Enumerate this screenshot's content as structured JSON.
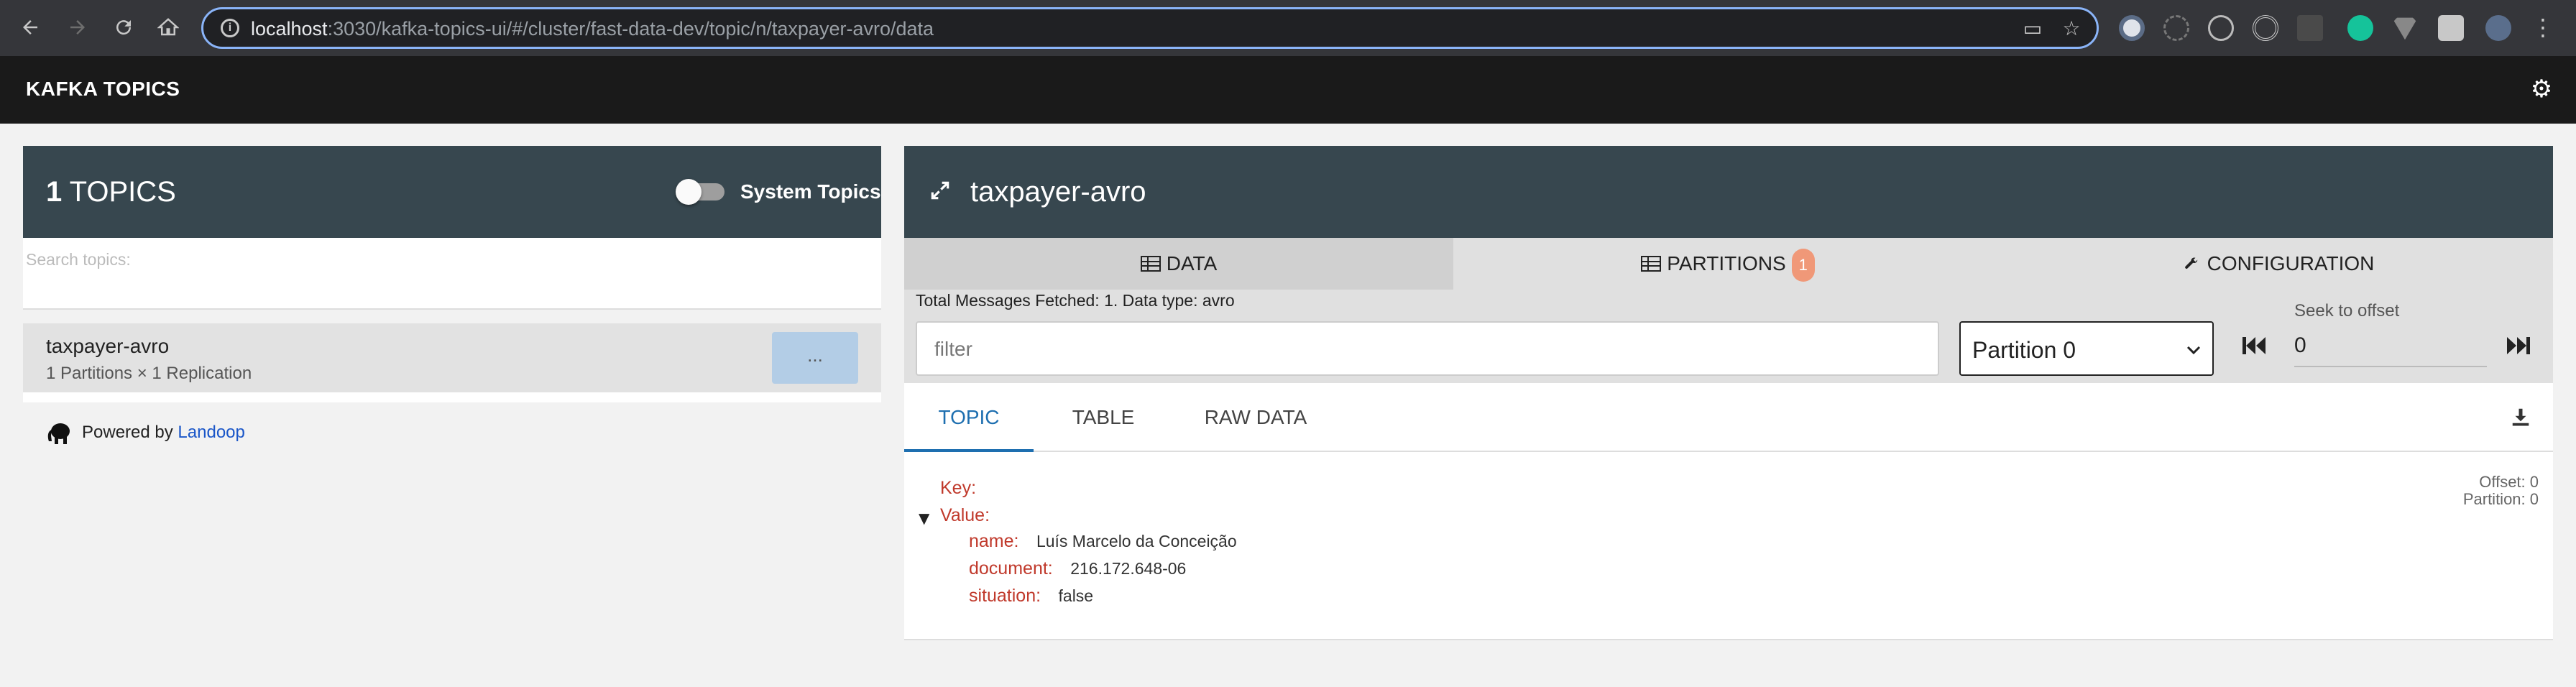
{
  "browser": {
    "url_host": "localhost",
    "url_rest": ":3030/kafka-topics-ui/#/cluster/fast-data-dev/topic/n/taxpayer-avro/data"
  },
  "app": {
    "title": "KAFKA TOPICS"
  },
  "topics_panel": {
    "count": "1",
    "count_label": "TOPICS",
    "system_topics_label": "System Topics",
    "search_placeholder": "Search topics:",
    "topics": [
      {
        "name": "taxpayer-avro",
        "meta": "1 Partitions × 1 Replication",
        "action_label": "..."
      }
    ],
    "powered_by": "Powered by",
    "powered_link": "Landoop"
  },
  "topic_panel": {
    "title": "taxpayer-avro",
    "tabs": [
      {
        "label": "DATA"
      },
      {
        "label": "PARTITIONS",
        "badge": "1"
      },
      {
        "label": "CONFIGURATION"
      }
    ],
    "fetched_text": "Total Messages Fetched: 1. Data type: avro",
    "filter_placeholder": "filter",
    "partition_selected": "Partition 0",
    "seek_label": "Seek to offset",
    "seek_value": "0",
    "subtabs": [
      "TOPIC",
      "TABLE",
      "RAW DATA"
    ],
    "message": {
      "key_label": "Key:",
      "value_label": "Value:",
      "offset": "Offset: 0",
      "partition": "Partition: 0",
      "fields": [
        {
          "key": "name:",
          "value": "Luís Marcelo da Conceição"
        },
        {
          "key": "document:",
          "value": "216.172.648-06"
        },
        {
          "key": "situation:",
          "value": "false"
        }
      ]
    }
  }
}
